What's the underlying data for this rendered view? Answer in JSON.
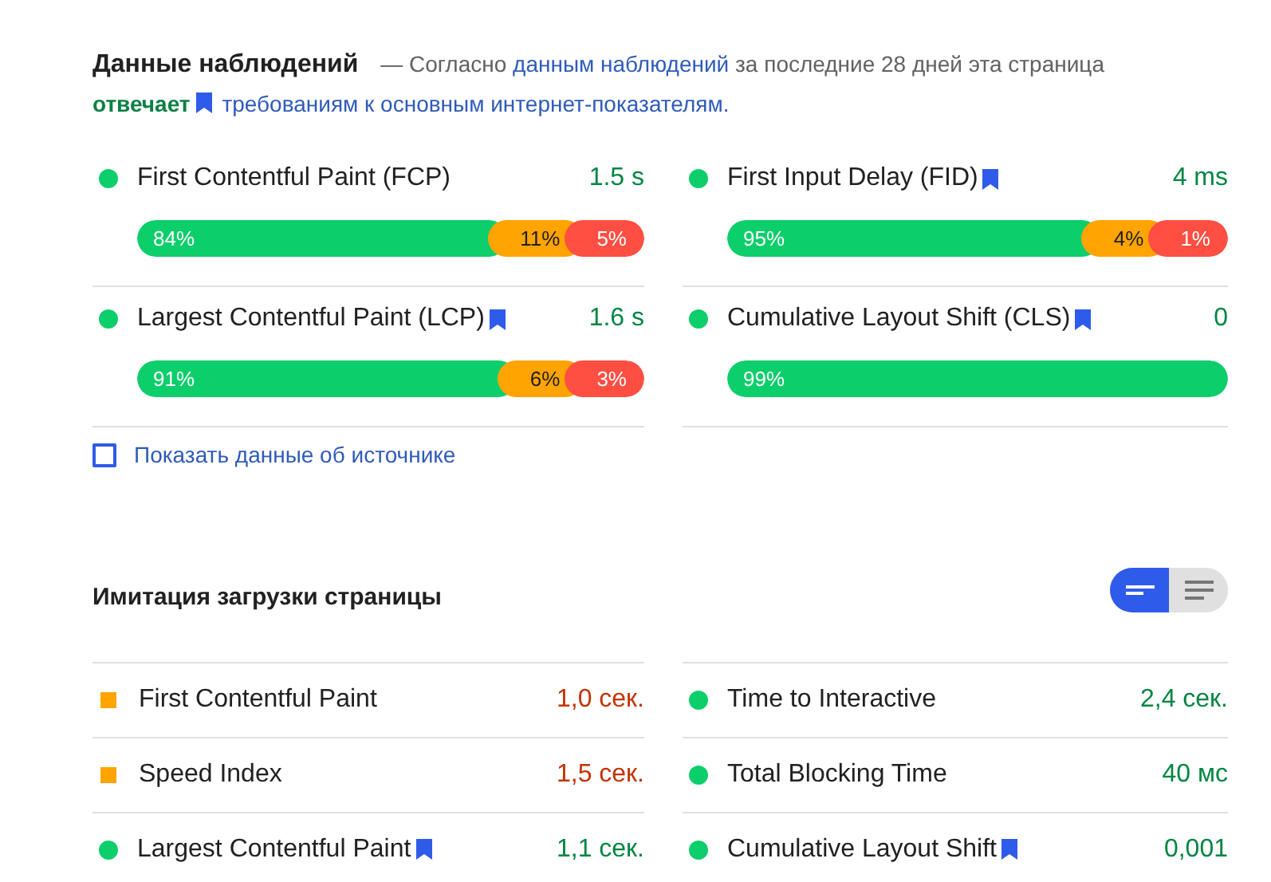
{
  "field_data": {
    "title": "Данные наблюдений",
    "summary": [
      {
        "kind": "text",
        "text": "— Согласно"
      },
      {
        "kind": "link",
        "text": "данным наблюдений"
      },
      {
        "kind": "text",
        "text": "за последние 28 дней эта страница"
      },
      {
        "kind": "status",
        "text": "отвечает"
      },
      {
        "kind": "bookmark_link",
        "text": "требованиям к основным интернет-показателям."
      }
    ],
    "metrics": [
      {
        "name": "First Contentful Paint (FCP)",
        "bookmark": false,
        "value": "1.5 s",
        "color": "#0cce6b",
        "distribution": [
          {
            "kind": "good",
            "label": "84%"
          },
          {
            "kind": "average",
            "label": "11%"
          },
          {
            "kind": "poor",
            "label": "5%"
          }
        ]
      },
      {
        "name": "First Input Delay (FID)",
        "bookmark": true,
        "value": "4 ms",
        "color": "#0cce6b",
        "distribution": [
          {
            "kind": "good",
            "label": "95%"
          },
          {
            "kind": "average",
            "label": "4%"
          },
          {
            "kind": "poor",
            "label": "1%"
          }
        ]
      },
      {
        "name": "Largest Contentful Paint (LCP)",
        "bookmark": true,
        "value": "1.6 s",
        "color": "#0cce6b",
        "distribution": [
          {
            "kind": "good",
            "label": "91%"
          },
          {
            "kind": "average",
            "label": "6%"
          },
          {
            "kind": "poor",
            "label": "3%"
          }
        ]
      },
      {
        "name": "Cumulative Layout Shift (CLS)",
        "bookmark": true,
        "value": "0",
        "color": "#0cce6b",
        "distribution": [
          {
            "kind": "good",
            "label": "99%"
          }
        ]
      }
    ],
    "origin_checkbox": {
      "label": "Показать данные об источнике",
      "checked": false
    }
  },
  "lab_data": {
    "title": "Имитация загрузки страницы",
    "view_toggle": [
      {
        "kind": "compact",
        "selected": true
      },
      {
        "kind": "expanded",
        "selected": false
      }
    ],
    "metrics": [
      {
        "name": "First Contentful Paint",
        "bookmark": false,
        "value": "1,0 сек.",
        "kind": "square",
        "color": "#ffa400"
      },
      {
        "name": "Time to Interactive",
        "bookmark": false,
        "value": "2,4 сек.",
        "kind": "circle",
        "color": "#0cce6b"
      },
      {
        "name": "Speed Index",
        "bookmark": false,
        "value": "1,5 сек.",
        "kind": "square",
        "color": "#ffa400"
      },
      {
        "name": "Total Blocking Time",
        "bookmark": false,
        "value": "40 мс",
        "kind": "circle",
        "color": "#0cce6b"
      },
      {
        "name": "Largest Contentful Paint",
        "bookmark": true,
        "value": "1,1 сек.",
        "kind": "circle",
        "color": "#0cce6b"
      },
      {
        "name": "Cumulative Layout Shift",
        "bookmark": true,
        "value": "0,001",
        "kind": "circle",
        "color": "#0cce6b"
      }
    ]
  }
}
